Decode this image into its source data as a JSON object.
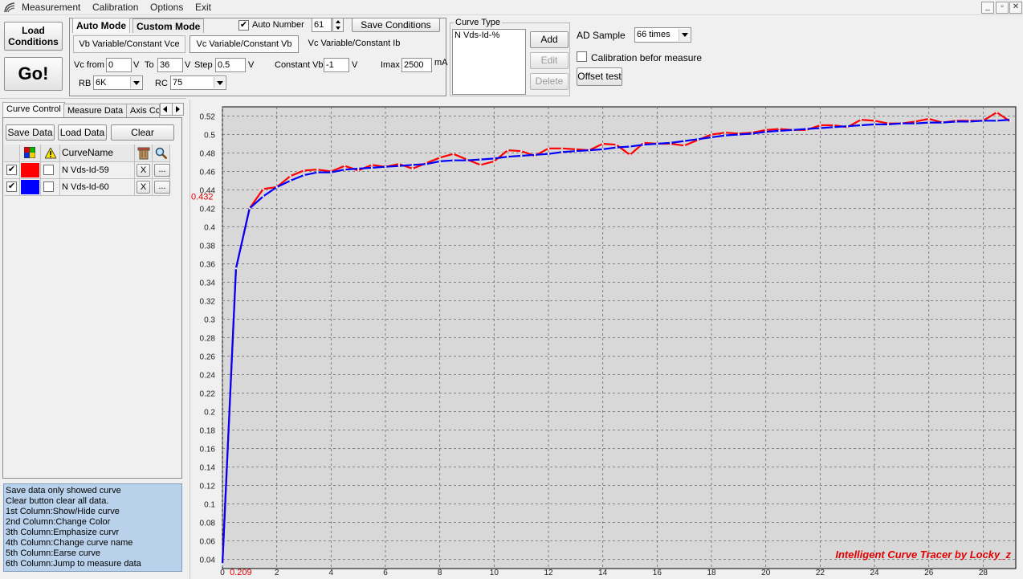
{
  "menubar": {
    "items": [
      "Measurement",
      "Calibration",
      "Options",
      "Exit"
    ],
    "window_buttons": [
      "_",
      "▫",
      "✕"
    ]
  },
  "left_buttons": {
    "load": "Load Conditions",
    "go": "Go!"
  },
  "mode_tabs": {
    "auto": "Auto Mode",
    "custom": "Custom Mode"
  },
  "auto_number": {
    "label": "Auto Number",
    "checked": true,
    "value": "61"
  },
  "save_conditions": "Save Conditions",
  "sub_tabs": [
    "Vb Variable/Constant Vce",
    "Vc Variable/Constant Vb",
    "Vc Variable/Constant Ib"
  ],
  "params": {
    "vc_from_label": "Vc from",
    "vc_from": "0",
    "v1": "V",
    "to_label": "To",
    "to": "36",
    "v2": "V",
    "step_label": "Step",
    "step": "0.5",
    "v3": "V",
    "constant_vb_label": "Constant Vb",
    "constant_vb": "-1",
    "v4": "V",
    "imax_label": "Imax",
    "imax": "2500",
    "imax_unit": "mA",
    "rb_label": "RB",
    "rb": "6K",
    "rc_label": "RC",
    "rc": "75"
  },
  "curve_type": {
    "title": "Curve Type",
    "item": "N Vds-Id-%",
    "add": "Add",
    "edit": "Edit",
    "delete": "Delete"
  },
  "ad_sample": {
    "label": "AD Sample",
    "value": "66 times"
  },
  "calibration": {
    "label": "Calibration befor measure",
    "checked": false
  },
  "offset_test": "Offset test",
  "panel_tabs": [
    "Curve Control",
    "Measure Data",
    "Axis Co"
  ],
  "panel_buttons": {
    "save": "Save Data",
    "load": "Load Data",
    "clear": "Clear"
  },
  "curve_table": {
    "header": "CurveName",
    "rows": [
      {
        "name": "N Vds-Id-59",
        "color": "#ff0000",
        "checked": true,
        "x": "X",
        "more": "..."
      },
      {
        "name": "N Vds-Id-60",
        "color": "#0000ff",
        "checked": true,
        "x": "X",
        "more": "..."
      }
    ]
  },
  "help_text": [
    "  Save data only showed curve",
    "  Clear button clear all data.",
    "1st Column:Show/Hide curve",
    "2nd Column:Change Color",
    "3th Column:Emphasize curvr",
    "4th Column:Change curve name",
    "5th Column:Earse curve",
    "6th Column:Jump to measure data"
  ],
  "chart_data": {
    "type": "line",
    "watermark": "Intelligent Curve Tracer by Locky_z",
    "cursor_y_label": "0.432",
    "cursor_x_label": "0.209",
    "xlim": [
      0,
      29.2
    ],
    "ylim": [
      0.03,
      0.53
    ],
    "x_ticks": [
      0,
      2,
      4,
      6,
      8,
      10,
      12,
      14,
      16,
      18,
      20,
      22,
      24,
      26,
      28
    ],
    "y_ticks": [
      0.04,
      0.06,
      0.08,
      0.1,
      0.12,
      0.14,
      0.16,
      0.18,
      0.2,
      0.22,
      0.24,
      0.26,
      0.28,
      0.3,
      0.32,
      0.34,
      0.36,
      0.38,
      0.4,
      0.42,
      0.44,
      0.46,
      0.48,
      0.5,
      0.52
    ],
    "series": [
      {
        "name": "N Vds-Id-59",
        "color": "#ff0000",
        "x": [
          0,
          0.5,
          1,
          1.5,
          2,
          2.5,
          3,
          3.5,
          4,
          4.5,
          5,
          5.5,
          6,
          6.5,
          7,
          7.5,
          8,
          8.5,
          9,
          9.5,
          10,
          10.5,
          11,
          11.5,
          12,
          12.5,
          13,
          13.5,
          14,
          14.5,
          15,
          15.5,
          16,
          16.5,
          17,
          17.5,
          18,
          18.5,
          19,
          19.5,
          20,
          20.5,
          21,
          21.5,
          22,
          22.5,
          23,
          23.5,
          24,
          24.5,
          25,
          25.5,
          26,
          26.5,
          27,
          27.5,
          28,
          28.5,
          29
        ],
        "y": [
          0.035,
          0.355,
          0.42,
          0.441,
          0.443,
          0.455,
          0.461,
          0.462,
          0.46,
          0.466,
          0.461,
          0.467,
          0.465,
          0.468,
          0.463,
          0.469,
          0.475,
          0.479,
          0.473,
          0.467,
          0.471,
          0.483,
          0.482,
          0.477,
          0.485,
          0.485,
          0.484,
          0.483,
          0.49,
          0.489,
          0.478,
          0.491,
          0.49,
          0.49,
          0.488,
          0.494,
          0.5,
          0.502,
          0.501,
          0.502,
          0.505,
          0.506,
          0.505,
          0.505,
          0.51,
          0.51,
          0.508,
          0.516,
          0.515,
          0.512,
          0.512,
          0.514,
          0.517,
          0.513,
          0.515,
          0.515,
          0.515,
          0.524,
          0.514
        ]
      },
      {
        "name": "N Vds-Id-60",
        "color": "#0000ff",
        "x": [
          0,
          0.5,
          1,
          1.5,
          2,
          2.5,
          3,
          3.5,
          4,
          4.5,
          5,
          5.5,
          6,
          6.5,
          7,
          7.5,
          8,
          8.5,
          9,
          9.5,
          10,
          10.5,
          11,
          11.5,
          12,
          12.5,
          13,
          13.5,
          14,
          14.5,
          15,
          15.5,
          16,
          16.5,
          17,
          17.5,
          18,
          18.5,
          19,
          19.5,
          20,
          20.5,
          21,
          21.5,
          22,
          22.5,
          23,
          23.5,
          24,
          24.5,
          25,
          25.5,
          26,
          26.5,
          27,
          27.5,
          28,
          28.5,
          29
        ],
        "y": [
          0.035,
          0.355,
          0.42,
          0.433,
          0.443,
          0.45,
          0.456,
          0.459,
          0.459,
          0.462,
          0.463,
          0.464,
          0.465,
          0.466,
          0.467,
          0.468,
          0.471,
          0.472,
          0.472,
          0.473,
          0.474,
          0.476,
          0.477,
          0.478,
          0.479,
          0.481,
          0.482,
          0.483,
          0.484,
          0.486,
          0.487,
          0.489,
          0.49,
          0.491,
          0.493,
          0.495,
          0.497,
          0.499,
          0.5,
          0.501,
          0.503,
          0.504,
          0.505,
          0.506,
          0.507,
          0.508,
          0.509,
          0.51,
          0.511,
          0.511,
          0.512,
          0.512,
          0.513,
          0.513,
          0.514,
          0.514,
          0.515,
          0.515,
          0.516
        ]
      }
    ]
  }
}
